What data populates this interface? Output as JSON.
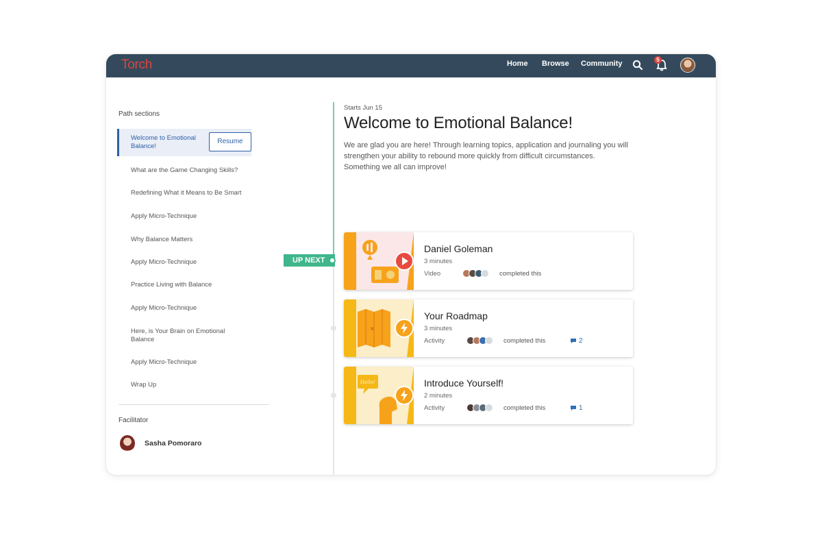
{
  "app": {
    "logo": "Torch"
  },
  "nav": {
    "home": "Home",
    "browse": "Browse",
    "community": "Community",
    "notifications_count": "5"
  },
  "sidebar": {
    "title": "Path sections",
    "items": [
      {
        "label": "Welcome to Emotional Balance!",
        "active": true
      },
      {
        "label": "What are the Game Changing Skills?"
      },
      {
        "label": "Redefining What it Means to Be Smart"
      },
      {
        "label": "Apply Micro-Technique"
      },
      {
        "label": "Why Balance Matters"
      },
      {
        "label": "Apply Micro-Technique"
      },
      {
        "label": "Practice Living with Balance"
      },
      {
        "label": "Apply Micro-Technique"
      },
      {
        "label": "Here, is Your Brain on Emotional Balance"
      },
      {
        "label": "Apply Micro-Technique"
      },
      {
        "label": "Wrap Up"
      }
    ],
    "resume_label": "Resume",
    "facilitator_label": "Facilitator",
    "facilitator_name": "Sasha Pomoraro"
  },
  "timeline": {
    "up_next": "UP NEXT"
  },
  "main": {
    "starts": "Starts Jun 15",
    "title": "Welcome to Emotional Balance!",
    "intro": "We are glad you are here! Through learning topics, application and journaling you will strengthen your ability to rebound more quickly from difficult circumstances. Something we all can improve!",
    "cards": [
      {
        "title": "Daniel Goleman",
        "duration": "3 minutes",
        "type": "Video",
        "completed": "completed this",
        "comments": ""
      },
      {
        "title": "Your Roadmap",
        "duration": "3 minutes",
        "type": "Activity",
        "completed": "completed this",
        "comments": "2"
      },
      {
        "title": "Introduce Yourself!",
        "duration": "2 minutes",
        "type": "Activity",
        "completed": "completed this",
        "comments": "1"
      }
    ]
  },
  "colors": {
    "topbar": "#344a5c",
    "accent": "#2f5fa7",
    "up_next": "#3fb68b",
    "thumb_orange": "#f7a21b",
    "thumb_yellow": "#f6b817"
  }
}
